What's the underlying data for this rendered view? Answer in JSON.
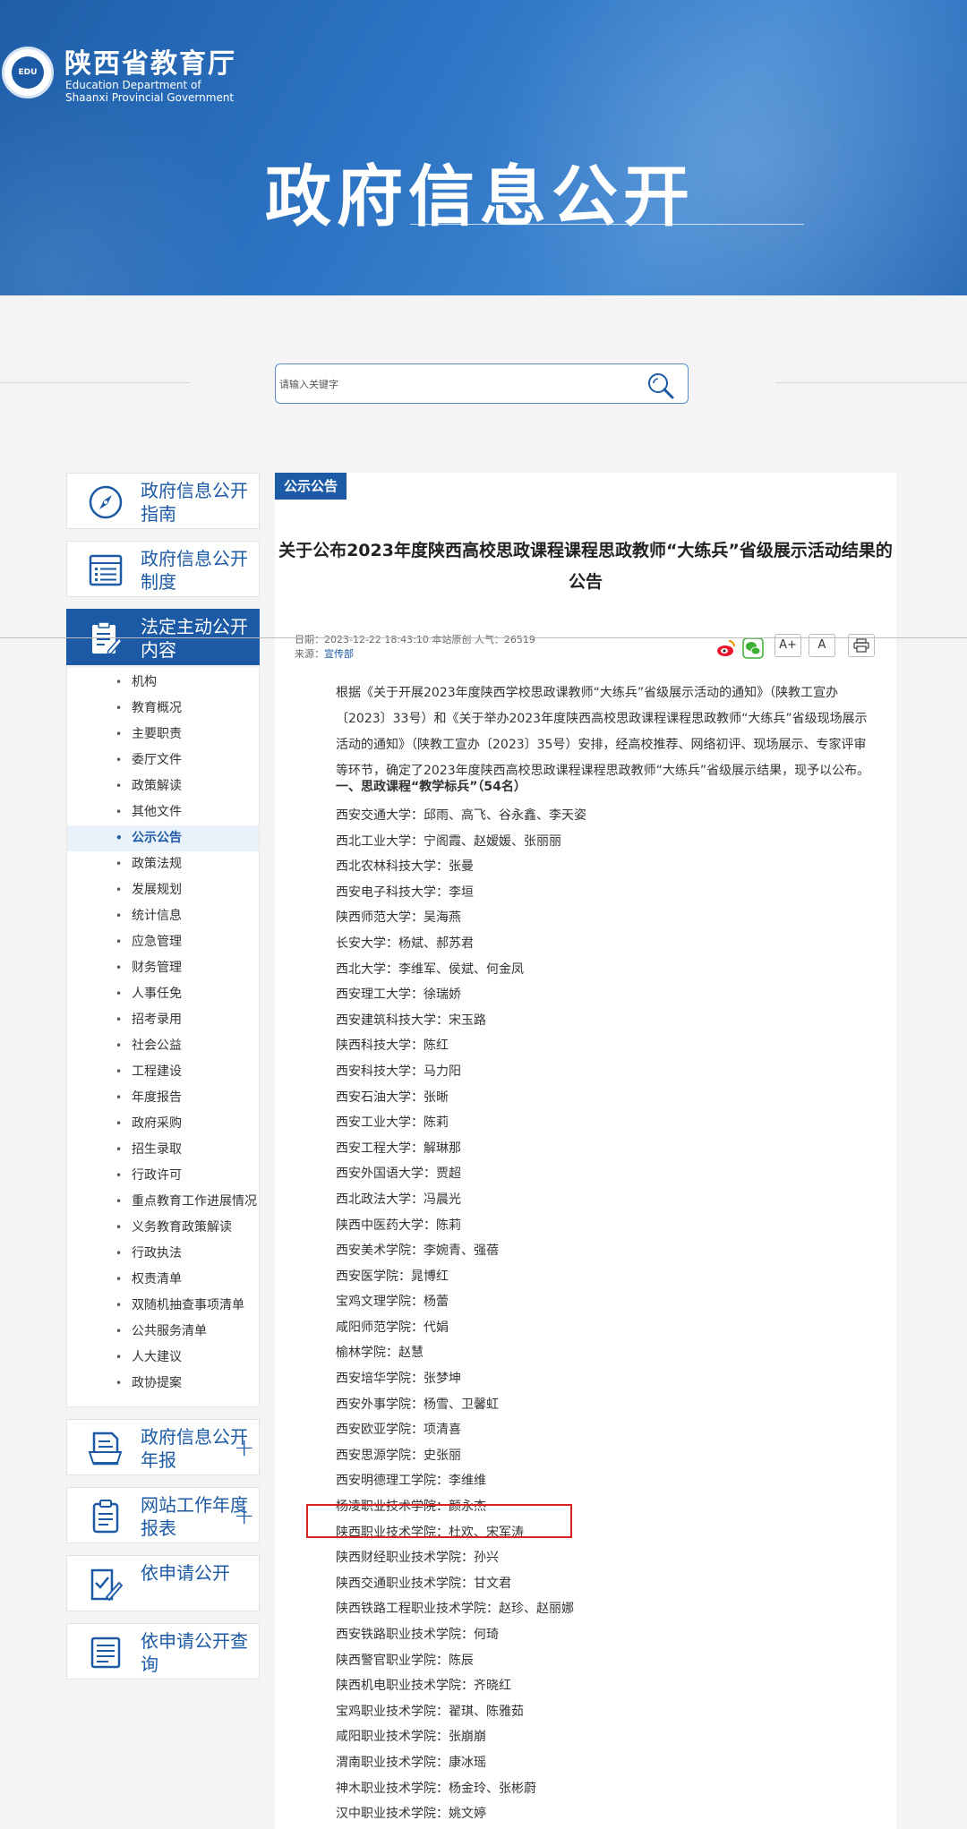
{
  "header": {
    "brand_cn": "陕西省教育厅",
    "brand_en_line1": "Education Department of",
    "brand_en_line2": "Shaanxi Provincial Government",
    "logo_text": "EDU",
    "banner_title": "政府信息公开"
  },
  "search": {
    "placeholder": "请输入关键字"
  },
  "sidebar": {
    "cards_top": [
      {
        "label": "政府信息公开指南",
        "icon": "compass-icon"
      },
      {
        "label": "政府信息公开制度",
        "icon": "list-document-icon"
      },
      {
        "label": "法定主动公开内容",
        "icon": "clipboard-edit-icon"
      }
    ],
    "items": [
      "机构",
      "教育概况",
      "主要职责",
      "委厅文件",
      "政策解读",
      "其他文件",
      "公示公告",
      "政策法规",
      "发展规划",
      "统计信息",
      "应急管理",
      "财务管理",
      "人事任免",
      "招考录用",
      "社会公益",
      "工程建设",
      "年度报告",
      "政府采购",
      "招生录取",
      "行政许可",
      "重点教育工作进展情况",
      "义务教育政策解读",
      "行政执法",
      "权责清单",
      "双随机抽查事项清单",
      "公共服务清单",
      "人大建议",
      "政协提案"
    ],
    "active_item": "公示公告",
    "cards_bottom": [
      {
        "label": "政府信息公开年报",
        "icon": "report-document-icon",
        "expand": "+"
      },
      {
        "label": "网站工作年度报表",
        "icon": "clipboard-list-icon",
        "expand": "+"
      },
      {
        "label": "依申请公开",
        "icon": "checklist-pen-icon"
      },
      {
        "label": "依申请公开查询",
        "icon": "document-lines-icon"
      }
    ]
  },
  "article": {
    "tag": "公示公告",
    "title": "关于公布2023年度陕西高校思政课程课程思政教师“大练兵”省级展示活动结果的公告",
    "meta_line1": "日期：2023-12-22 18:43:10    本站原创    人气：26519",
    "source_label": "来源：",
    "source_link": "宣传部",
    "tools": {
      "font_large": "A+",
      "font_small": "A",
      "print_icon": "print-icon",
      "weibo_icon": "weibo-icon",
      "wechat_icon": "wechat-icon"
    },
    "intro": "根据《关于开展2023年度陕西学校思政课教师“大练兵”省级展示活动的通知》（陕教工宣办〔2023〕33号）和《关于举办2023年度陕西高校思政课程课程思政教师“大练兵”省级现场展示活动的通知》（陕教工宣办〔2023〕35号）安排，经高校推荐、网络初评、现场展示、专家评审等环节，确定了2023年度陕西高校思政课程课程思政教师“大练兵”省级展示结果，现予以公布。",
    "section_title": "一、思政课程“教学标兵”（54名）",
    "entries": [
      "西安交通大学：邱雨、高飞、谷永鑫、李天姿",
      "西北工业大学：宁阁霞、赵嫒媛、张丽丽",
      "西北农林科技大学：张曼",
      "西安电子科技大学：李垣",
      "陕西师范大学：吴海燕",
      "长安大学：杨斌、郝苏君",
      "西北大学：李维军、侯斌、何金凤",
      "西安理工大学：徐瑞娇",
      "西安建筑科技大学：宋玉路",
      "陕西科技大学：陈红",
      "西安科技大学：马力阳",
      "西安石油大学：张晰",
      "西安工业大学：陈莉",
      "西安工程大学：解琳那",
      "西安外国语大学：贾超",
      "西北政法大学：冯晨光",
      "陕西中医药大学：陈莉",
      "西安美术学院：李婉青、强蓓",
      "西安医学院：晁博红",
      "宝鸡文理学院：杨蕾",
      "咸阳师范学院：代娟",
      "榆林学院：赵慧",
      "西安培华学院：张梦坤",
      "西安外事学院：杨雪、卫馨虹",
      "西安欧亚学院：项清喜",
      "西安思源学院：史张丽",
      "西安明德理工学院：李维维",
      "杨凌职业技术学院：颜永杰",
      "陕西职业技术学院：杜欢、宋军涛",
      "陕西财经职业技术学院：孙兴",
      "陕西交通职业技术学院：甘文君",
      "陕西铁路工程职业技术学院：赵珍、赵丽娜",
      "西安铁路职业技术学院：何琦",
      "陕西警官职业学院：陈辰",
      "陕西机电职业技术学院：齐晓红",
      "宝鸡职业技术学院：翟琪、陈雅茹",
      "咸阳职业技术学院：张崩崩",
      "渭南职业技术学院：康冰瑶",
      "神木职业技术学院：杨金玲、张彬蔚",
      "汉中职业技术学院：姚文婷"
    ],
    "highlighted_entry": "神木职业技术学院：杨金玲、张彬蔚",
    "highlight_color": "#d72323"
  },
  "colors": {
    "brand_blue": "#1d5aa5",
    "banner_blue": "#2d74c4"
  }
}
